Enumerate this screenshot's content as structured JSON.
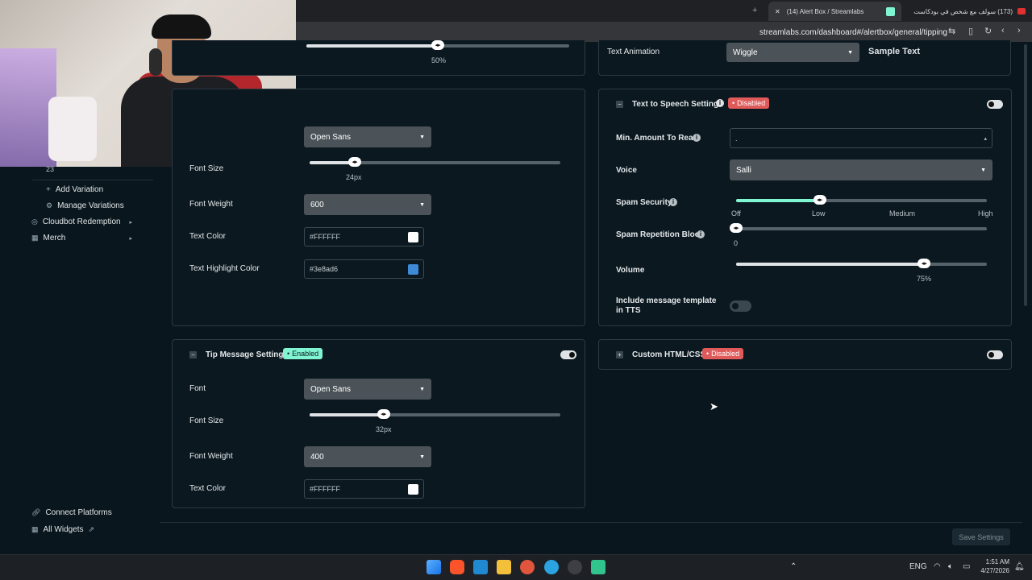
{
  "browser": {
    "tabs": [
      {
        "label": "(14) Alert Box / Streamlabs"
      },
      {
        "label": "(173) سولف مع شخص في بودكاست"
      }
    ],
    "url": "streamlabs.com/dashboard#/alertbox/general/tipping"
  },
  "sidebar": {
    "count": "23",
    "items": [
      {
        "label": "Add Variation",
        "icon": "plus-icon"
      },
      {
        "label": "Manage Variations",
        "icon": "gear-icon"
      },
      {
        "label": "Cloudbot Redemption",
        "icon": "cloudbot-icon"
      },
      {
        "label": "Merch",
        "icon": "shirt-icon"
      }
    ],
    "footer": [
      {
        "label": "Connect Platforms",
        "icon": "link-icon"
      },
      {
        "label": "All Widgets",
        "icon": "grid-icon"
      }
    ]
  },
  "top_left": {
    "value": "50%",
    "fraction": 0.5
  },
  "text_animation": {
    "label": "Text Animation",
    "value": "Wiggle",
    "sample": "Sample Text"
  },
  "message_settings": {
    "font_value": "Open Sans",
    "font_size_label": "Font Size",
    "font_size_value": "24px",
    "font_size_fraction": 0.18,
    "font_weight_label": "Font Weight",
    "font_weight_value": "600",
    "text_color_label": "Text Color",
    "text_color_value": "#FFFFFF",
    "text_color_swatch": "#ffffff",
    "highlight_label": "Text Highlight Color",
    "highlight_value": "#3e8ad6",
    "highlight_swatch": "#3e8ad6"
  },
  "tts": {
    "title": "Text to Speech Settings",
    "status": "Disabled",
    "min_amount_label": "Min. Amount To Read",
    "min_amount_value": ".",
    "voice_label": "Voice",
    "voice_value": "Salli",
    "spam_security_label": "Spam Security",
    "spam_security_ticks": [
      "Off",
      "Low",
      "Medium",
      "High"
    ],
    "spam_security_fraction": 0.333,
    "spam_repetition_label": "Spam Repetition Block",
    "spam_repetition_value": "0",
    "spam_repetition_fraction": 0.0,
    "volume_label": "Volume",
    "volume_value": "75%",
    "volume_fraction": 0.75,
    "include_template_label": "Include message template in TTS"
  },
  "tip_message": {
    "title": "Tip Message Settings",
    "status": "Enabled",
    "font_label": "Font",
    "font_value": "Open Sans",
    "font_size_label": "Font Size",
    "font_size_value": "32px",
    "font_size_fraction": 0.295,
    "font_weight_label": "Font Weight",
    "font_weight_value": "400",
    "text_color_label": "Text Color",
    "text_color_value": "#FFFFFF",
    "text_color_swatch": "#ffffff"
  },
  "custom_html": {
    "title": "Custom HTML/CSS",
    "status": "Disabled"
  },
  "save_button": "Save Settings",
  "taskbar": {
    "lang": "ENG",
    "time": "1:51 AM",
    "date": "4/27/2026"
  },
  "colors": {
    "accent": "#80f5d2",
    "disabled": "#e05a5a",
    "panel": "#0b1820"
  }
}
